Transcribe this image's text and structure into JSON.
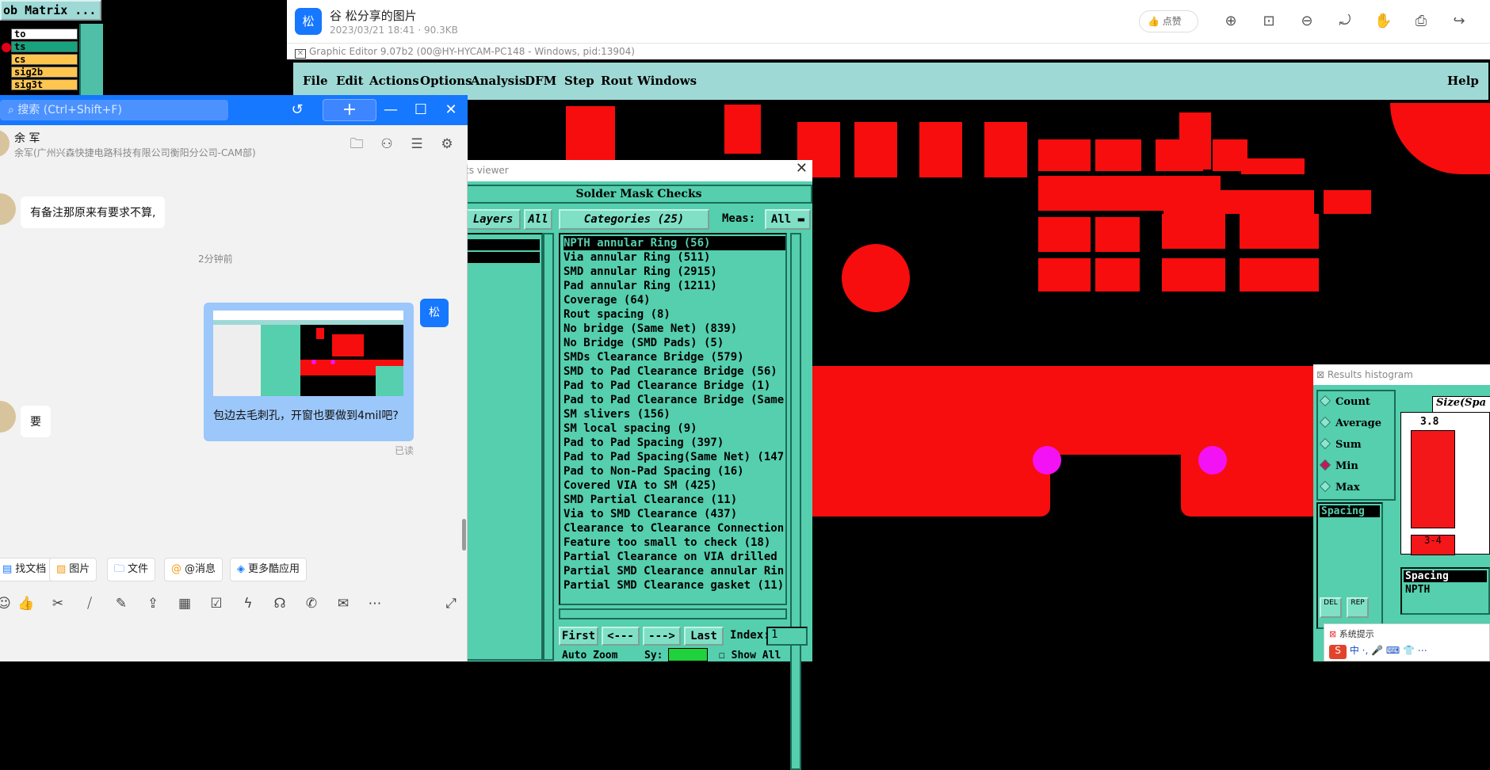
{
  "matrix": {
    "title": "ob Matrix ...",
    "layers": [
      {
        "name": "to",
        "bg": "#ffffff"
      },
      {
        "name": "ts",
        "bg": "#17a37e"
      },
      {
        "name": "cs",
        "bg": "#ffc64f"
      },
      {
        "name": "sig2b",
        "bg": "#ffc64f"
      },
      {
        "name": "sig3t",
        "bg": "#ffc64f"
      }
    ]
  },
  "viewer": {
    "avatar": "松",
    "title": "谷 松分享的图片",
    "meta": "2023/03/21 18:41 · 90.3KB",
    "like_label": "点赞"
  },
  "editor": {
    "title": "Graphic Editor 9.07b2 (00@HY-HYCAM-PC148 - Windows, pid:13904)",
    "menus": [
      "File",
      "Edit",
      "Actions",
      "Options",
      "Analysis",
      "DFM",
      "Step",
      "Rout",
      "Windows"
    ],
    "help": "Help"
  },
  "results_viewer": {
    "title": "ts viewer",
    "header": "Solder Mask Checks",
    "layers_btn": "Layers",
    "all_btn": "All",
    "categories_btn": "Categories (25)",
    "meas_label": "Meas:",
    "meas_value": "All",
    "categories": [
      "NPTH annular Ring (56)",
      "Via annular Ring (511)",
      "SMD annular Ring (2915)",
      "Pad annular Ring (1211)",
      "Coverage (64)",
      "Rout spacing (8)",
      "No bridge (Same Net) (839)",
      "No Bridge (SMD Pads) (5)",
      "SMDs Clearance Bridge (579)",
      "SMD to Pad Clearance Bridge (56)",
      "Pad to Pad Clearance Bridge (1)",
      "Pad to Pad Clearance Bridge (Same",
      "SM slivers (156)",
      "SM local spacing (9)",
      "Pad to Pad Spacing (397)",
      "Pad to Pad Spacing(Same Net) (147",
      "Pad to Non-Pad Spacing (16)",
      "Covered VIA to SM (425)",
      "SMD Partial Clearance (11)",
      "Via to SMD Clearance (437)",
      "Clearance to Clearance Connection",
      "Feature too small to check (18)",
      "Partial Clearance on VIA drilled",
      "Partial SMD Clearance annular Rin",
      "Partial SMD Clearance gasket (11)"
    ],
    "nav": {
      "first": "First",
      "prev": "<---",
      "next": "--->",
      "last": "Last",
      "index_label": "Index:",
      "index_value": "1"
    },
    "bottom": {
      "zoom": "Auto Zoom",
      "sy": "Sy:",
      "show_all": "Show All"
    }
  },
  "histogram": {
    "title": "Results histogram",
    "options": [
      "Count",
      "Average",
      "Sum",
      "Min",
      "Max"
    ],
    "selected": "Min",
    "size_label": "Size(Spa",
    "bar_label_top": "3.8",
    "bar_label_bottom": "3-4",
    "spacing_item": "Spacing",
    "detail_header": "Spacing",
    "detail_row": "NPTH",
    "btn_del": "DEL",
    "btn_rep": "REP"
  },
  "sys_tip": {
    "title": "系统提示",
    "ime": "中 ·, 🎤 ⌨ 👕 ⋯"
  },
  "chat": {
    "search_placeholder": "搜索 (Ctrl+Shift+F)",
    "contact_name": "余 军",
    "contact_sub": "余军(广州兴森快捷电路科技有限公司衡阳分公司-CAM部)",
    "messages": {
      "m1": "有备注那原来有要求不算,",
      "timestamp": "2分钟前",
      "self_avatar": "松",
      "out_text": "包边去毛刺孔，开窗也要做到4mil吧?",
      "read": "已读",
      "m2": "要"
    },
    "tools": [
      "找文档",
      "图片",
      "文件",
      "@消息",
      "更多酷应用"
    ]
  }
}
